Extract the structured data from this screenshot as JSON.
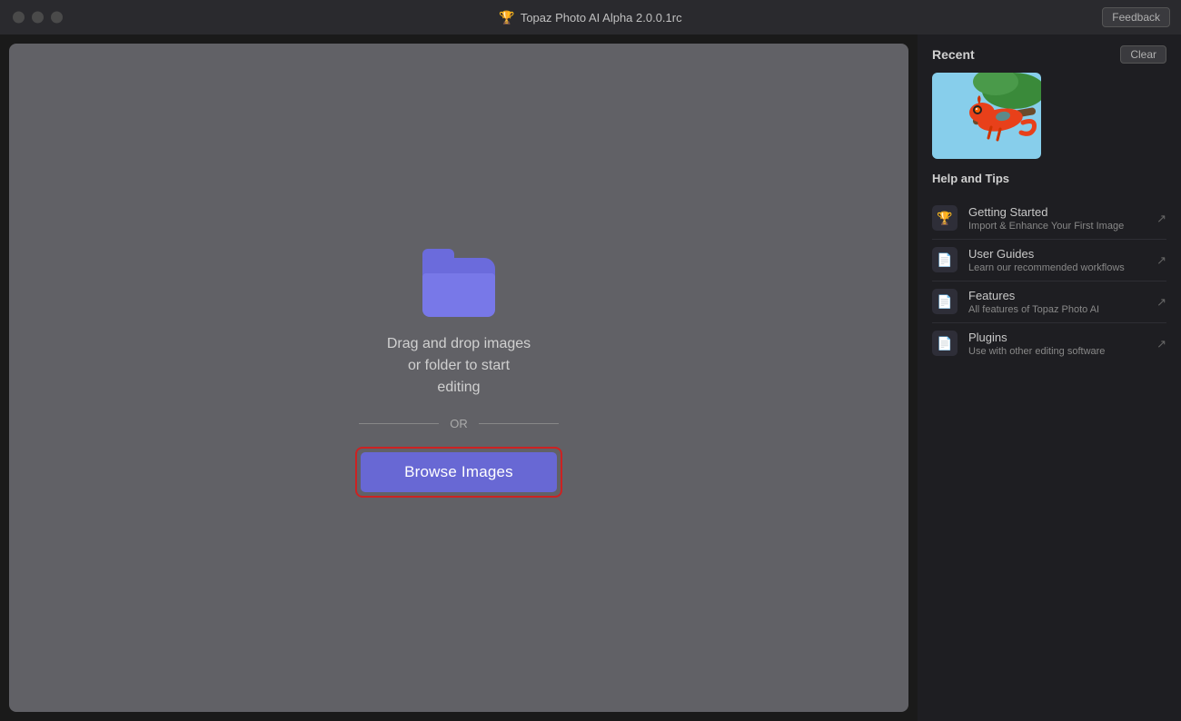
{
  "titlebar": {
    "title": "Topaz Photo AI Alpha 2.0.0.1rc",
    "feedback_label": "Feedback"
  },
  "dropzone": {
    "drag_text": "Drag and drop images\nor folder to start\nediting",
    "or_text": "OR",
    "browse_label": "Browse Images"
  },
  "sidebar": {
    "recent_label": "Recent",
    "clear_label": "Clear",
    "help_title": "Help and Tips",
    "help_items": [
      {
        "icon": "trophy",
        "title": "Getting Started",
        "desc": "Import & Enhance Your First Image"
      },
      {
        "icon": "doc",
        "title": "User Guides",
        "desc": "Learn our recommended workflows"
      },
      {
        "icon": "doc",
        "title": "Features",
        "desc": "All features of Topaz Photo AI"
      },
      {
        "icon": "doc",
        "title": "Plugins",
        "desc": "Use with other editing software"
      }
    ]
  }
}
